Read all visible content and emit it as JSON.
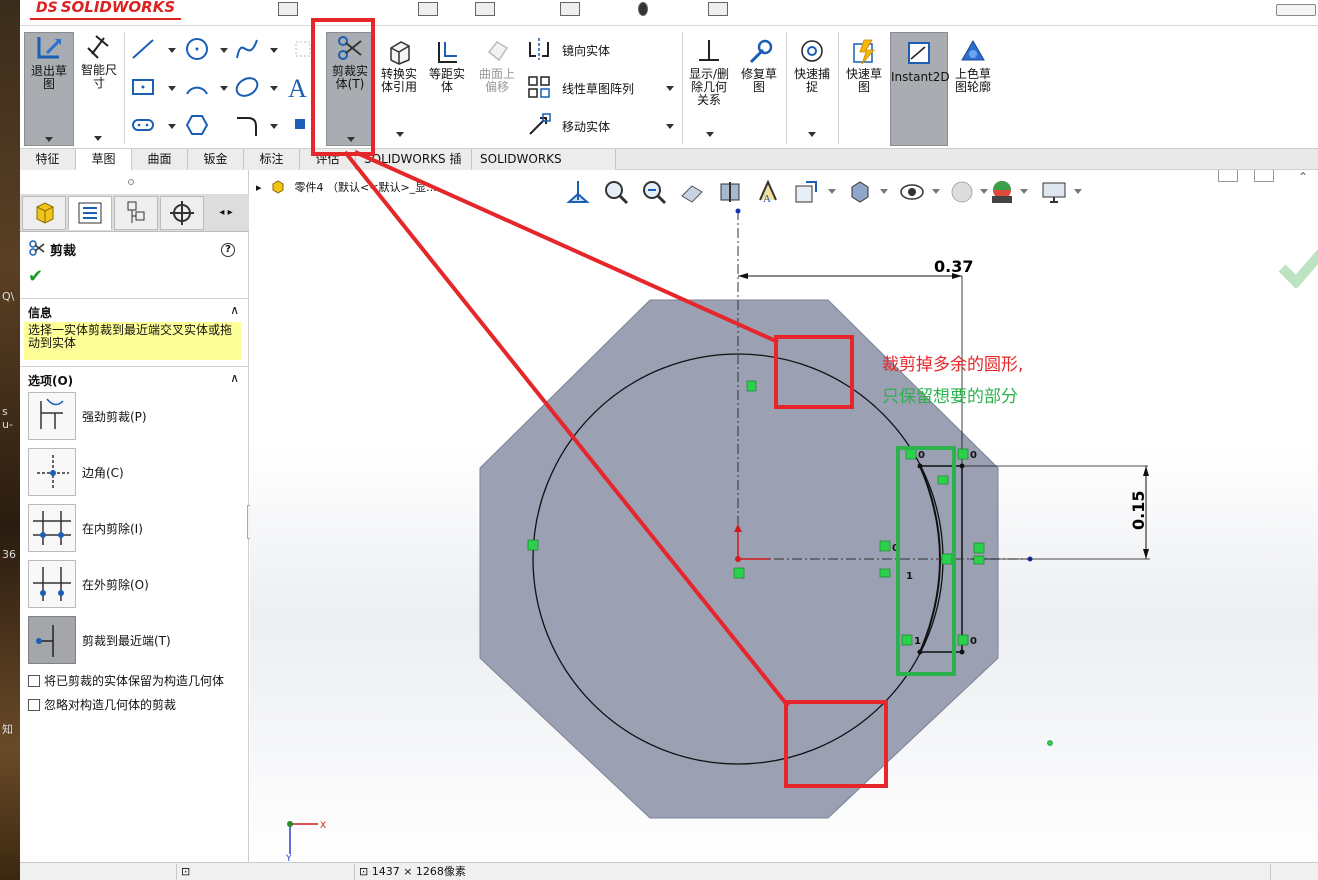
{
  "app": {
    "logo_prefix": "DS",
    "logo_text": "SOLIDWORKS"
  },
  "left_strip": {
    "chips": [
      "Q\\",
      "s u-",
      "36",
      "知"
    ]
  },
  "ribbon": {
    "exit_sketch": "退出草\n图",
    "smart_dim": "智能尺\n寸",
    "trim": "剪裁实\n体(T)",
    "convert": "转换实\n体引用",
    "offset": "等距实\n体",
    "surface_offset": "曲面上\n偏移",
    "mirror": "镜向实体",
    "linear_pattern": "线性草图阵列",
    "move": "移动实体",
    "display_delete": "显示/删\n除几何\n关系",
    "repair": "修复草\n图",
    "quick_snaps": "快速捕\n捉",
    "rapid_sketch": "快速草\n图",
    "instant2d": "Instant2D",
    "shaded_contours": "上色草\n图轮廓"
  },
  "tabs": [
    "特征",
    "草图",
    "曲面",
    "钣金",
    "标注",
    "评估",
    "SOLIDWORKS 插件",
    "SOLIDWORKS Inspection"
  ],
  "pm": {
    "title": "剪裁",
    "info_header": "信息",
    "info_text": "选择一实体剪裁到最近端交叉实体或拖动到实体",
    "options_header": "选项(O)",
    "options": [
      "强劲剪裁(P)",
      "边角(C)",
      "在内剪除(I)",
      "在外剪除(O)",
      "剪裁到最近端(T)"
    ],
    "checkboxes": [
      "将已剪裁的实体保留为构造几何体",
      "忽略对构造几何体的剪裁"
    ],
    "help": "?"
  },
  "graphics": {
    "tree_label": "零件4 （默认<<默认>_显...",
    "dimensions": {
      "horizontal": "0.37",
      "vertical": "0.15"
    },
    "annotation_line1": "裁剪掉多余的圆形,",
    "annotation_line2": "只保留想要的部分",
    "relation_labels": [
      "0",
      "0",
      "0",
      "1",
      "0",
      "1"
    ],
    "triad": {
      "x": "X",
      "y": "Y"
    },
    "colors": {
      "red": "#e5262a",
      "green": "#2bb24c",
      "body": "#9ba0b3"
    }
  },
  "statusbar": {
    "size": "1437 × 1268像素"
  }
}
